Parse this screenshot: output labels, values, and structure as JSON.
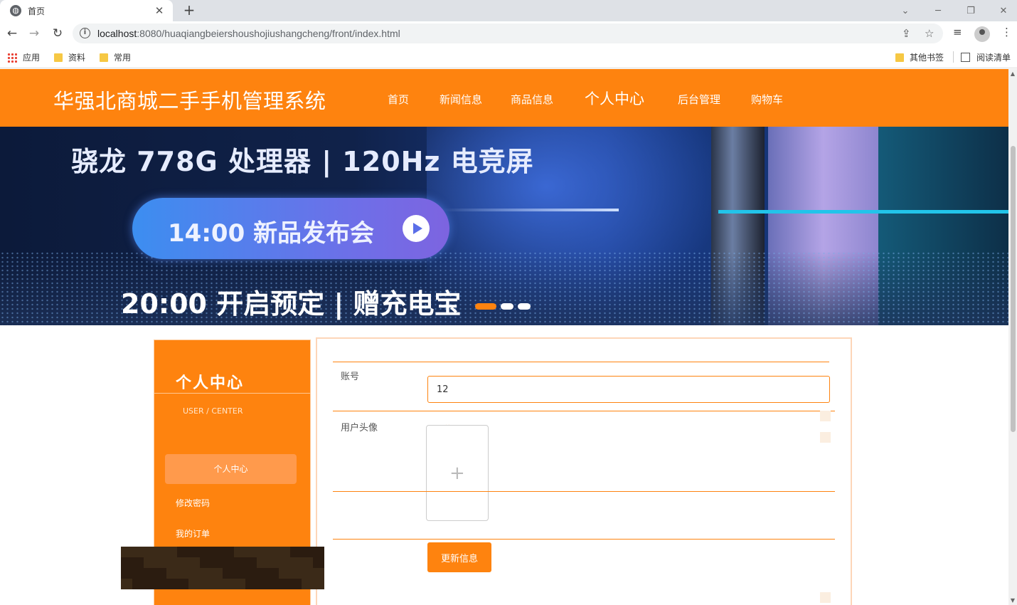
{
  "browser": {
    "tab_title": "首页",
    "url_host": "localhost",
    "url_port_path": ":8080/huaqiangbeiershoushojiushangcheng/front/index.html",
    "bookmarks": [
      "应用",
      "资料",
      "常用"
    ],
    "bookmarks_right": [
      "其他书签",
      "阅读清单"
    ]
  },
  "site": {
    "title": "华强北商城二手手机管理系统",
    "nav": [
      "首页",
      "新闻信息",
      "商品信息",
      "个人中心",
      "后台管理",
      "购物车"
    ],
    "active_nav": "个人中心"
  },
  "banner": {
    "headline": "骁龙 778G 处理器 | 120Hz 电竞屏",
    "pill_text": "14:00 新品发布会",
    "subline": "20:00 开启预定 | 赠充电宝",
    "slide_count": 3,
    "active_slide": 1,
    "colors": {
      "accent": "#fe830f",
      "cyan": "#22c4ea"
    }
  },
  "sidebar": {
    "title": "个人中心",
    "subtitle": "USER / CENTER",
    "items": [
      "个人中心",
      "修改密码",
      "我的订单"
    ]
  },
  "form": {
    "account_label": "账号",
    "account_value": "12",
    "avatar_label": "用户头像",
    "avatar_upload_label": "上传",
    "submit_label": "更新信息"
  },
  "theme": {
    "primary": "#fe830f"
  }
}
